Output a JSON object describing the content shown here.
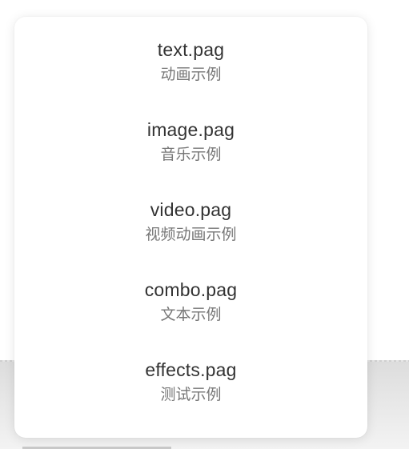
{
  "menu": {
    "items": [
      {
        "title": "text.pag",
        "subtitle": "动画示例"
      },
      {
        "title": "image.pag",
        "subtitle": "音乐示例"
      },
      {
        "title": "video.pag",
        "subtitle": "视频动画示例"
      },
      {
        "title": "combo.pag",
        "subtitle": "文本示例"
      },
      {
        "title": "effects.pag",
        "subtitle": "测试示例"
      }
    ]
  },
  "colors": {
    "title_text": "#333333",
    "subtitle_text": "#777777",
    "menu_background": "#ffffff",
    "backdrop": "#e0e0e0"
  }
}
